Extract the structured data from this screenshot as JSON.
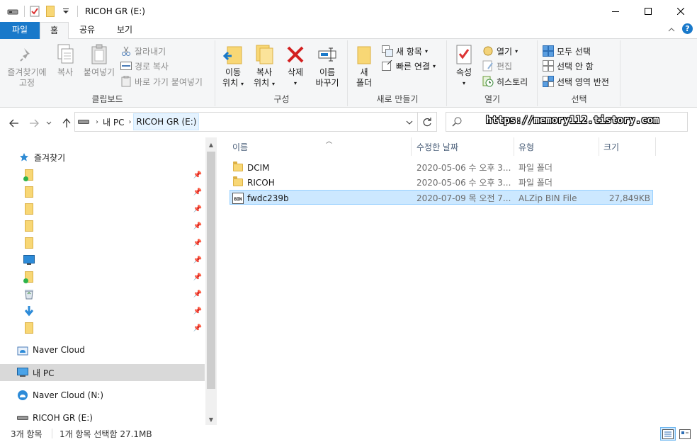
{
  "window": {
    "title": "RICOH GR (E:)"
  },
  "ribbon_tabs": [
    "파일",
    "홈",
    "공유",
    "보기"
  ],
  "ribbon": {
    "clipboard": {
      "pin_label_1": "즐겨찾기에",
      "pin_label_2": "고정",
      "copy": "복사",
      "paste": "붙여넣기",
      "cut": "잘라내기",
      "copy_path": "경로 복사",
      "paste_shortcut": "바로 가기 붙여넣기",
      "label": "클립보드"
    },
    "organize": {
      "move_1": "이동",
      "move_2": "위치",
      "copy_1": "복사",
      "copy_2": "위치",
      "delete": "삭제",
      "rename_1": "이름",
      "rename_2": "바꾸기",
      "label": "구성"
    },
    "new": {
      "new_folder_1": "새",
      "new_folder_2": "폴더",
      "new_item": "새 항목",
      "easy_access": "빠른 연결",
      "label": "새로 만들기"
    },
    "open": {
      "properties": "속성",
      "open": "열기",
      "edit": "편집",
      "history": "히스토리",
      "label": "열기"
    },
    "select": {
      "select_all": "모두 선택",
      "select_none": "선택 안 함",
      "invert": "선택 영역 반전",
      "label": "선택"
    }
  },
  "address": {
    "root": "내 PC",
    "current": "RICOH GR (E:)",
    "watermark": "https://memory112.tistory.com"
  },
  "nav": {
    "quick_access": "즐겨찾기",
    "naver_cloud": "Naver Cloud",
    "this_pc": "내 PC",
    "naver_cloud_n": "Naver Cloud (N:)",
    "ricoh": "RICOH GR (E:)"
  },
  "columns": {
    "name": "이름",
    "modified": "수정한 날짜",
    "type": "유형",
    "size": "크기"
  },
  "files": [
    {
      "name": "DCIM",
      "modified": "2020-05-06 수 오후 3...",
      "type": "파일 폴더",
      "size": "",
      "icon": "folder-icon"
    },
    {
      "name": "RICOH",
      "modified": "2020-05-06 수 오후 3...",
      "type": "파일 폴더",
      "size": "",
      "icon": "folder-icon"
    },
    {
      "name": "fwdc239b",
      "modified": "2020-07-09 목 오전 7...",
      "type": "ALZip BIN File",
      "size": "27,849KB",
      "icon": "bin-file-icon"
    }
  ],
  "status": {
    "count": "3개 항목",
    "selected": "1개 항목 선택함 27.1MB"
  },
  "colors": {
    "accent": "#1979ca",
    "selection": "#cce8ff",
    "folder": "#f8d775"
  }
}
